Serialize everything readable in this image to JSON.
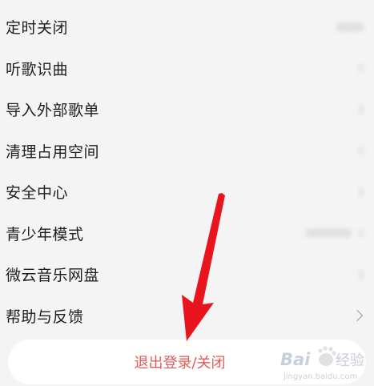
{
  "menu": {
    "items": [
      {
        "label": "定时关闭",
        "right": "value-pill"
      },
      {
        "label": "听歌识曲",
        "right": "dot"
      },
      {
        "label": "导入外部歌单",
        "right": "dot"
      },
      {
        "label": "清理占用空间",
        "right": "dot"
      },
      {
        "label": "安全中心",
        "right": "dot"
      },
      {
        "label": "青少年模式",
        "right": "value-pill"
      },
      {
        "label": "微云音乐网盘",
        "right": "dot"
      },
      {
        "label": "帮助与反馈",
        "right": "chevron-right-icon"
      }
    ]
  },
  "logout": {
    "label": "退出登录/关闭",
    "color": "#e05a5a"
  },
  "annotation": {
    "arrow_color": "#e8141e"
  },
  "watermark": {
    "brand": "Baidu经验",
    "url": "jingyan.baidu.com"
  }
}
